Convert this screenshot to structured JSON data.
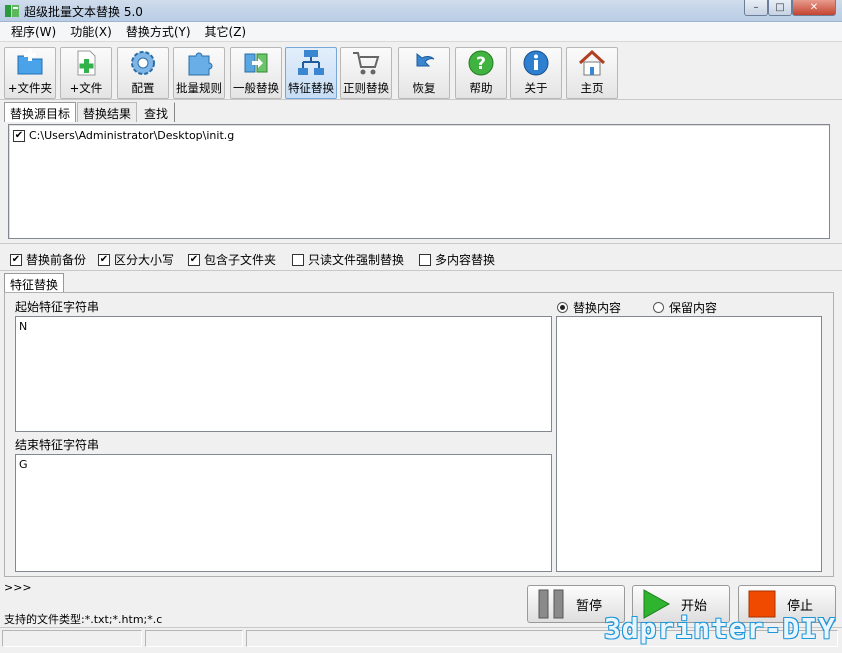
{
  "window": {
    "title": "超级批量文本替换 5.0",
    "min": "–",
    "max": "□",
    "close": "✕"
  },
  "menu": [
    "程序(W)",
    "功能(X)",
    "替换方式(Y)",
    "其它(Z)"
  ],
  "toolbar": [
    {
      "label": "+文件夹",
      "icon": "folder-add-icon"
    },
    {
      "label": "+文件",
      "icon": "file-add-icon"
    },
    {
      "label": "配置",
      "icon": "gear-icon"
    },
    {
      "label": "批量规则",
      "icon": "puzzle-icon"
    },
    {
      "label": "一般替换",
      "icon": "swap-icon"
    },
    {
      "label": "特征替换",
      "icon": "flowchart-icon",
      "active": true
    },
    {
      "label": "正则替换",
      "icon": "cart-icon"
    },
    {
      "label": "恢复",
      "icon": "undo-icon"
    },
    {
      "label": "帮助",
      "icon": "help-icon"
    },
    {
      "label": "关于",
      "icon": "info-icon"
    },
    {
      "label": "主页",
      "icon": "home-icon"
    }
  ],
  "tabs_top": [
    "替换源目标",
    "替换结果",
    "查找"
  ],
  "files": [
    {
      "checked": true,
      "path": "C:\\Users\\Administrator\\Desktop\\init.g"
    }
  ],
  "check_mark": "✔",
  "options": [
    {
      "label": "替换前备份",
      "checked": true
    },
    {
      "label": "区分大小写",
      "checked": true
    },
    {
      "label": "包含子文件夹",
      "checked": true
    },
    {
      "label": "只读文件强制替换",
      "checked": false
    },
    {
      "label": "多内容替换",
      "checked": false
    }
  ],
  "tabs_mid": [
    "特征替换"
  ],
  "feature": {
    "start_label": "起始特征字符串",
    "start_value": "N",
    "end_label": "结束特征字符串",
    "end_value": "G",
    "radio_replace": "替换内容",
    "radio_keep": "保留内容",
    "selected": "replace"
  },
  "log_prompt": ">>>",
  "file_types": "支持的文件类型:*.txt;*.htm;*.c",
  "buttons": {
    "pause": "暂停",
    "start": "开始",
    "stop": "停止"
  },
  "watermark": "3dprinter-DIY",
  "colors": {
    "accent": "#3a86d1",
    "start_green": "#2fb42f",
    "stop_red": "#f04a00"
  }
}
